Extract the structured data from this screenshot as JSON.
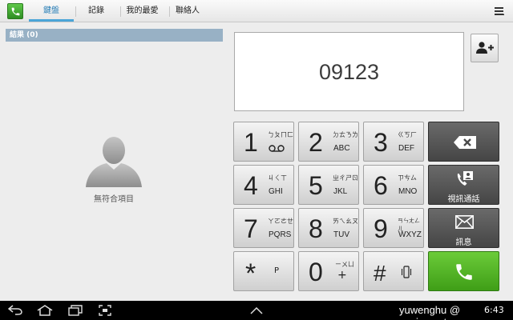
{
  "tabs": {
    "keypad": "鍵盤",
    "logs": "記錄",
    "favorites": "我的最愛",
    "contacts": "聯絡人"
  },
  "results": {
    "header": "結果 (0)",
    "empty_message": "無符合項目"
  },
  "display": {
    "number": "09123"
  },
  "keys": [
    {
      "digit": "1",
      "zhuyin": "ㄅㄆㄇㄈ",
      "letters": ""
    },
    {
      "digit": "2",
      "zhuyin": "ㄉㄊㄋㄌ",
      "letters": "ABC"
    },
    {
      "digit": "3",
      "zhuyin": "ㄍㄎㄏ",
      "letters": "DEF"
    },
    {
      "digit": "4",
      "zhuyin": "ㄐㄑㄒ",
      "letters": "GHI"
    },
    {
      "digit": "5",
      "zhuyin": "ㄓㄔㄕㄖ",
      "letters": "JKL"
    },
    {
      "digit": "6",
      "zhuyin": "ㄗㄘㄙ",
      "letters": "MNO"
    },
    {
      "digit": "7",
      "zhuyin": "ㄚㄛㄜㄝ",
      "letters": "PQRS"
    },
    {
      "digit": "8",
      "zhuyin": "ㄞㄟㄠㄡ",
      "letters": "TUV"
    },
    {
      "digit": "9",
      "zhuyin": "ㄢㄣㄤㄥㄦ",
      "letters": "WXYZ"
    },
    {
      "digit": "*",
      "zhuyin": "",
      "letters": "P"
    },
    {
      "digit": "0",
      "zhuyin": "ㄧㄨㄩ",
      "letters": "+"
    },
    {
      "digit": "#",
      "zhuyin": "",
      "letters": ""
    }
  ],
  "actions": {
    "video_call": "視訊通話",
    "message": "訊息"
  },
  "statusbar": {
    "clock": "6:43"
  },
  "watermark": "yuwenghu @ sogi.com.tw",
  "colors": {
    "accent": "#4aa5d8",
    "results_header": "#98b1c5",
    "call_green": "#4fae22",
    "dark_key": "#555555"
  }
}
